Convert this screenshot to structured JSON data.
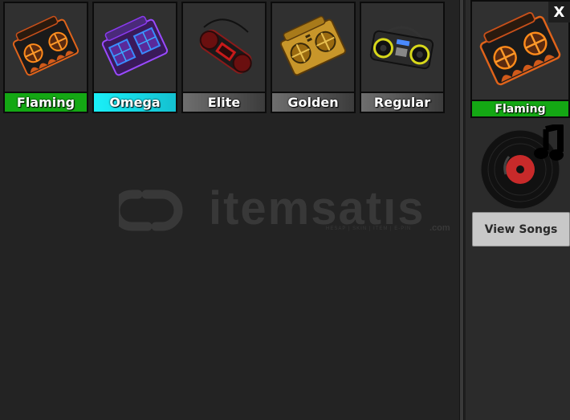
{
  "inventory": {
    "items": [
      {
        "label": "Flaming",
        "color": "#14a814",
        "style": "flaming"
      },
      {
        "label": "Omega",
        "color": "#19e5ef",
        "style": "omega"
      },
      {
        "label": "Elite",
        "color": "#5a5a5a",
        "style": "elite"
      },
      {
        "label": "Golden",
        "color": "#5a5a5a",
        "style": "golden"
      },
      {
        "label": "Regular",
        "color": "#5a5a5a",
        "style": "regular"
      }
    ]
  },
  "selected": {
    "label": "Flaming",
    "color": "#14a814"
  },
  "close_label": "X",
  "view_songs_label": "View Songs",
  "watermark": {
    "text": "itemsatıs",
    "sub": "HESAP | SKIN | ITEM | E-PIN",
    "com": ".com"
  }
}
